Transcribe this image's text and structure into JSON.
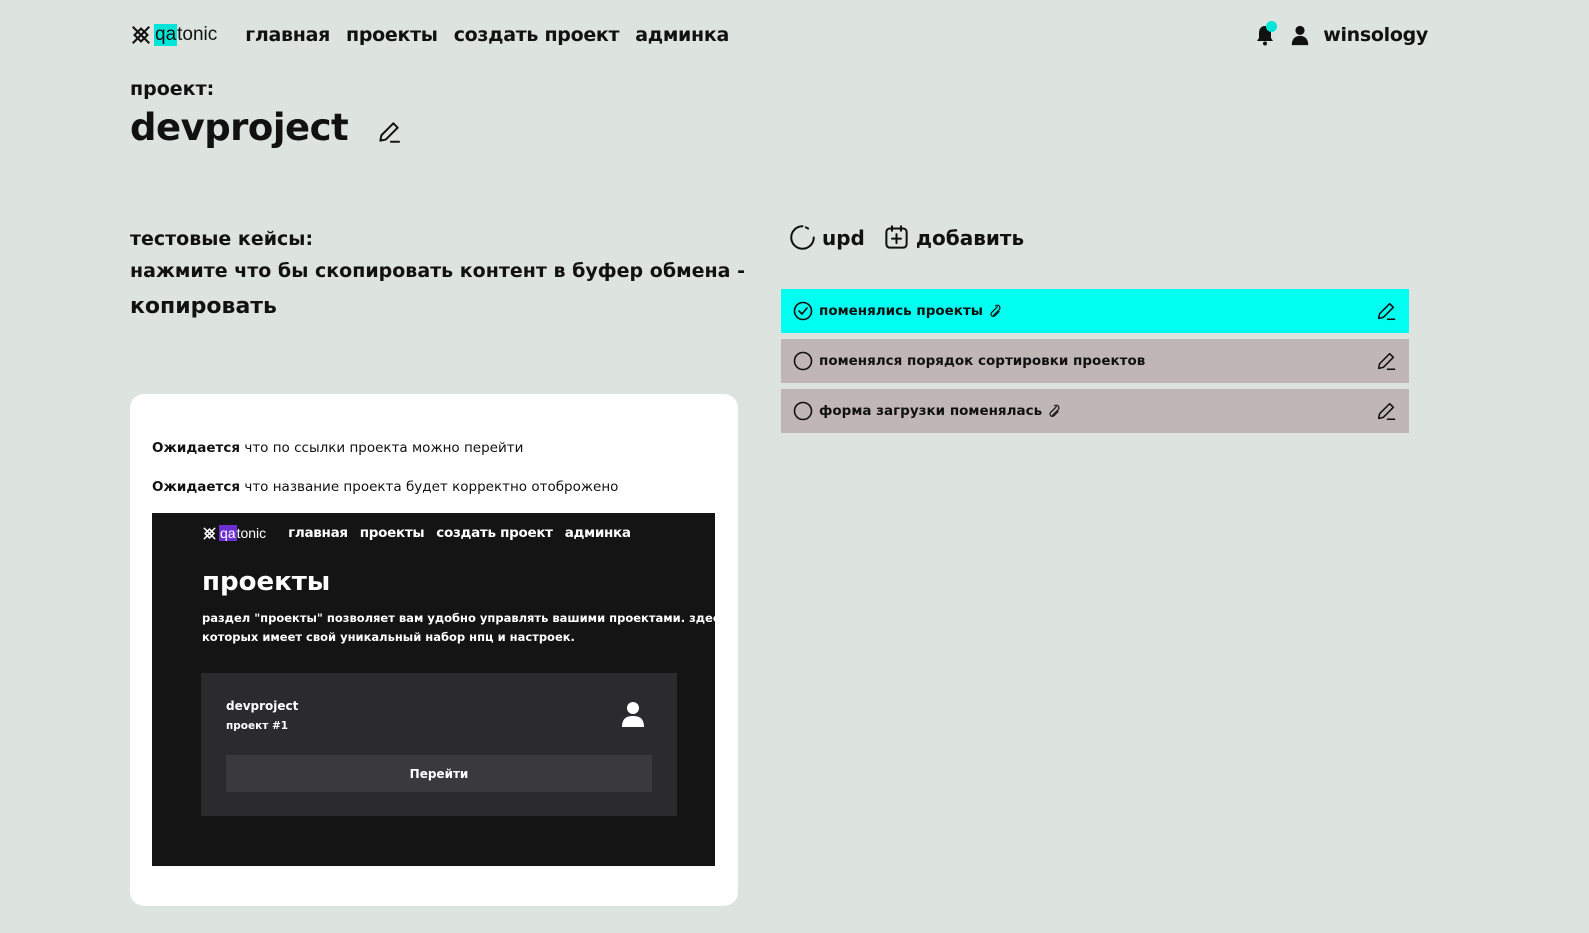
{
  "header": {
    "logo_prefix": "qa",
    "logo_suffix": "tonic",
    "nav": [
      "главная",
      "проекты",
      "создать проект",
      "админка"
    ],
    "username": "winsology",
    "accent": "#00e5d8"
  },
  "project": {
    "label": "проект:",
    "name": "devproject"
  },
  "testcases": {
    "label": "тестовые кейсы:",
    "hint": "нажмите что бы скопировать контент в буфер обмена -",
    "copy_label": "копировать"
  },
  "card": {
    "lines": [
      {
        "bold": "Ожидается",
        "text": " что по ссылки проекта можно перейти"
      },
      {
        "bold": "Ожидается",
        "text": " что название проекта будет корректно отоброжено"
      }
    ],
    "screenshot": {
      "logo_prefix": "qa",
      "logo_suffix": "tonic",
      "nav": [
        "главная",
        "проекты",
        "создать проект",
        "админка"
      ],
      "title": "проекты",
      "desc_line1": "раздел \"проекты\" позволяет вам удобно управлять вашими проектами. здесь вы мож",
      "desc_line2": "которых имеет свой уникальный набор нпц и настроек.",
      "project_name": "devproject",
      "project_number": "проект #1",
      "go_button": "Перейти"
    }
  },
  "actions": {
    "upd_label": "upd",
    "add_label": "добавить"
  },
  "cases": [
    {
      "title": "поменялись проекты",
      "done": true,
      "attachment": true,
      "active": true
    },
    {
      "title": "поменялся порядок сортировки проектов",
      "done": false,
      "attachment": false,
      "active": false
    },
    {
      "title": "форма загрузки поменялась",
      "done": false,
      "attachment": true,
      "active": false
    }
  ],
  "colors": {
    "background": "#dde3df",
    "active_case": "#00fff0",
    "case": "#c1b6b6"
  },
  "icons": [
    "logo-icon",
    "bell-icon",
    "user-icon",
    "edit-icon",
    "refresh-icon",
    "add-calendar-icon",
    "check-circle-icon",
    "circle-icon",
    "paperclip-icon",
    "pencil-icon"
  ]
}
